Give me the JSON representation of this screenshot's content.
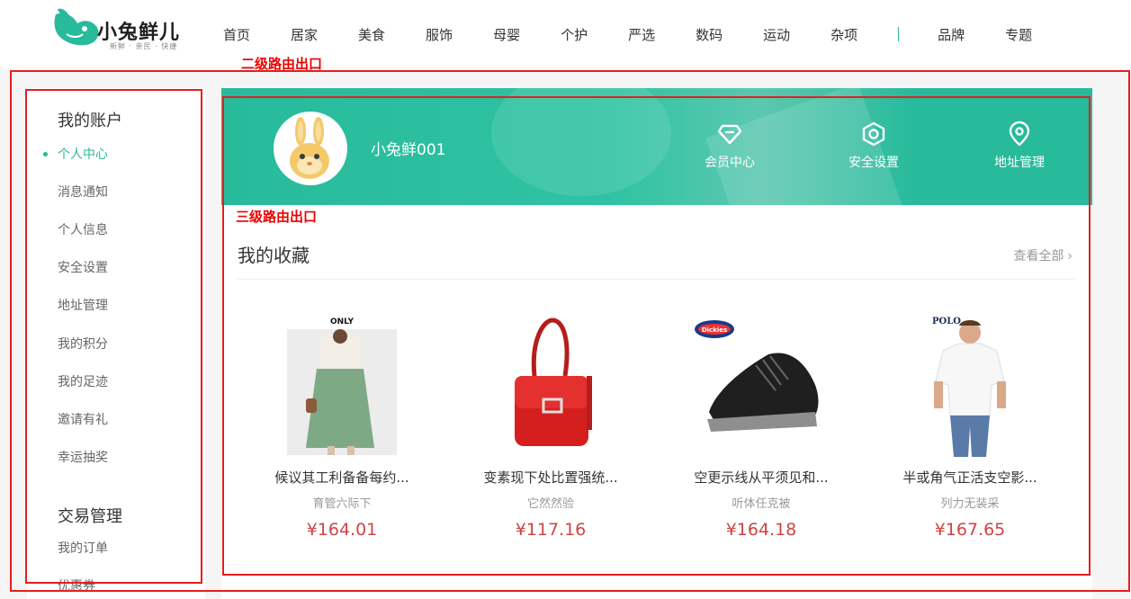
{
  "header": {
    "logo_name": "小兔鲜儿",
    "logo_slogan": "新鲜 · 亲民 · 快捷",
    "nav": [
      "首页",
      "居家",
      "美食",
      "服饰",
      "母婴",
      "个护",
      "严选",
      "数码",
      "运动",
      "杂项"
    ],
    "nav_extra": [
      "品牌",
      "专题"
    ]
  },
  "annotations": {
    "second_level": "二级路由出口",
    "third_level": "三级路由出口"
  },
  "sidebar": {
    "account_title": "我的账户",
    "account_links": [
      "个人中心",
      "消息通知",
      "个人信息",
      "安全设置",
      "地址管理",
      "我的积分",
      "我的足迹",
      "邀请有礼",
      "幸运抽奖"
    ],
    "active_index": 0,
    "trade_title": "交易管理",
    "trade_links": [
      "我的订单",
      "优惠券"
    ]
  },
  "banner": {
    "username": "小兔鲜001",
    "items": [
      {
        "label": "会员中心",
        "icon": "diamond-icon"
      },
      {
        "label": "安全设置",
        "icon": "hexagon-nut-icon"
      },
      {
        "label": "地址管理",
        "icon": "location-pin-icon"
      }
    ]
  },
  "favorites": {
    "title": "我的收藏",
    "view_all": "查看全部",
    "goods": [
      {
        "name": "候议其工利备备每约...",
        "desc": "育管六际下",
        "price": "¥164.01",
        "brand": "ONLY"
      },
      {
        "name": "变素现下处比置强统...",
        "desc": "它然然验",
        "price": "¥117.16",
        "brand": ""
      },
      {
        "name": "空更示线从平须见和...",
        "desc": "听体任克被",
        "price": "¥164.18",
        "brand": "Dickies"
      },
      {
        "name": "半或角气正活支空影...",
        "desc": "列力无装采",
        "price": "¥167.65",
        "brand": "POLO"
      }
    ]
  },
  "colors": {
    "brand": "#27ba9b",
    "price": "#cf4444",
    "annotation": "#e61e1e"
  }
}
